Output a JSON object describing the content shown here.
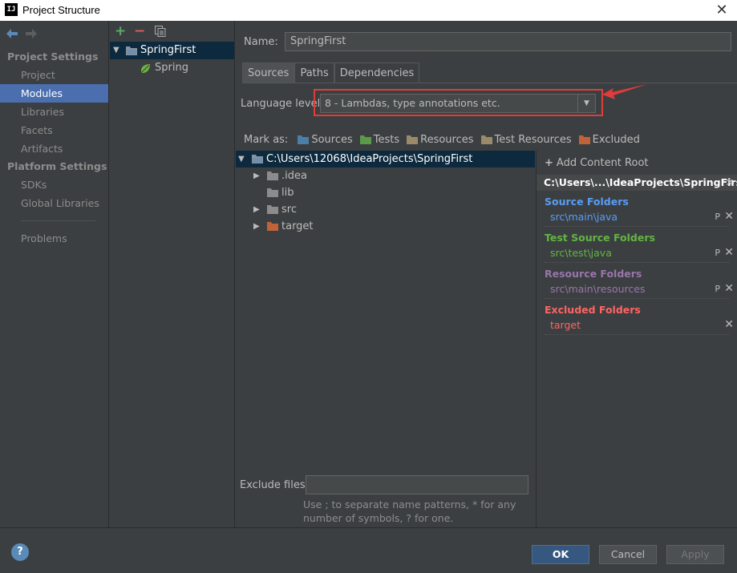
{
  "window": {
    "title": "Project Structure",
    "app_icon": "IJ",
    "close_glyph": "✕"
  },
  "nav": {
    "groups": [
      {
        "label": "Project Settings",
        "items": [
          "Project",
          "Modules",
          "Libraries",
          "Facets",
          "Artifacts"
        ]
      },
      {
        "label": "Platform Settings",
        "items": [
          "SDKs",
          "Global Libraries"
        ]
      }
    ],
    "extra": "Problems",
    "selected": "Modules"
  },
  "modules": {
    "toolbar": {
      "add": "+",
      "remove": "−"
    },
    "items": [
      {
        "label": "SpringFirst",
        "icon": "module-folder-icon",
        "selected": true
      },
      {
        "label": "Spring",
        "icon": "spring-leaf-icon"
      }
    ]
  },
  "module": {
    "name_label": "Name:",
    "name_value": "SpringFirst",
    "tabs": [
      "Sources",
      "Paths",
      "Dependencies"
    ],
    "active_tab": "Sources",
    "language_level_label": "Language level:",
    "language_level_value": "8 - Lambdas, type annotations etc.",
    "mark_as_label": "Mark as:",
    "mark_as": [
      {
        "label": "Sources",
        "color": "#4a7fa8"
      },
      {
        "label": "Tests",
        "color": "#5a9a4a"
      },
      {
        "label": "Resources",
        "color": "#9b8a6a"
      },
      {
        "label": "Test Resources",
        "color": "#9b8a6a"
      },
      {
        "label": "Excluded",
        "color": "#c0633a"
      }
    ]
  },
  "tree": {
    "root": "C:\\Users\\12068\\IdeaProjects\\SpringFirst",
    "children": [
      {
        "label": ".idea",
        "expandable": true,
        "color": "#8c8c8c"
      },
      {
        "label": "lib",
        "expandable": false,
        "color": "#8c8c8c"
      },
      {
        "label": "src",
        "expandable": true,
        "color": "#8c8c8c"
      },
      {
        "label": "target",
        "expandable": true,
        "color": "#c0633a"
      }
    ]
  },
  "content_root": {
    "add_label": "Add Content Root",
    "header": "C:\\Users\\...\\IdeaProjects\\SpringFirst",
    "groups": [
      {
        "title": "Source Folders",
        "path": "src\\main\\java",
        "title_color": "#589df6",
        "path_color": "#589df6",
        "has_props": true
      },
      {
        "title": "Test Source Folders",
        "path": "src\\test\\java",
        "title_color": "#62b543",
        "path_color": "#62b543",
        "has_props": true
      },
      {
        "title": "Resource Folders",
        "path": "src\\main\\resources",
        "title_color": "#9876aa",
        "path_color": "#9876aa",
        "has_props": true
      },
      {
        "title": "Excluded Folders",
        "path": "target",
        "title_color": "#ff6464",
        "path_color": "#ff6464",
        "has_props": false
      }
    ]
  },
  "exclude": {
    "label": "Exclude files:",
    "value": "",
    "hint": "Use ; to separate name patterns, * for any number of symbols, ? for one."
  },
  "footer": {
    "help": "?",
    "ok": "OK",
    "cancel": "Cancel",
    "apply": "Apply"
  }
}
